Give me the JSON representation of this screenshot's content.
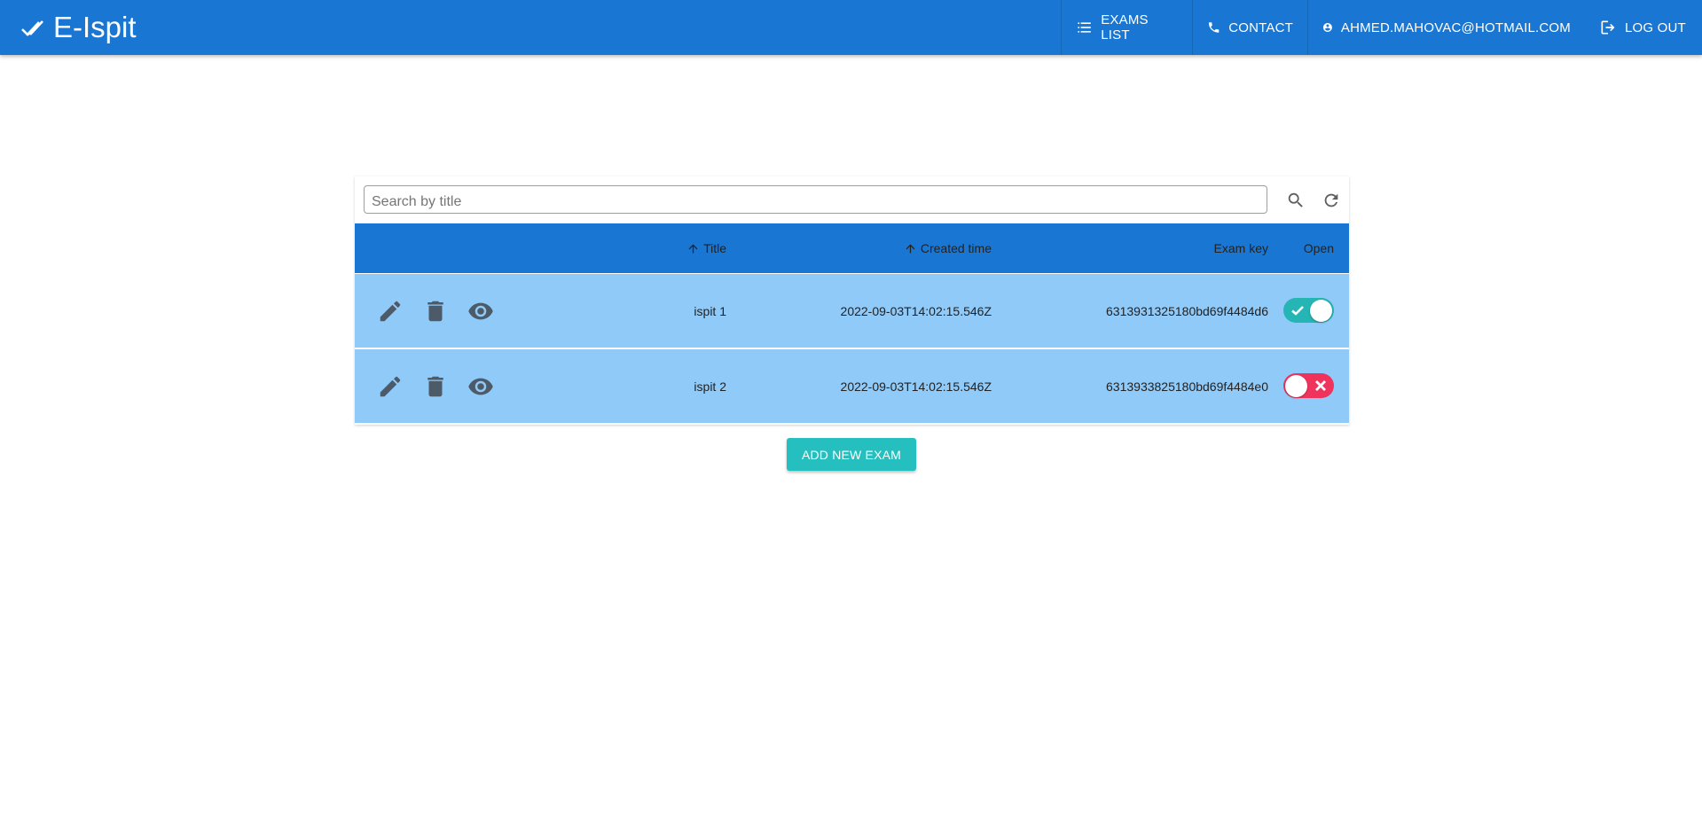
{
  "app": {
    "brand": "E-Ispit"
  },
  "nav": {
    "exams_list": "EXAMS LIST",
    "contact": "CONTACT",
    "user": "AHMED.MAHOVAC@HOTMAIL.COM",
    "logout": "LOG OUT"
  },
  "search": {
    "placeholder": "Search by title",
    "value": ""
  },
  "table": {
    "columns": {
      "title": "Title",
      "created": "Created time",
      "key": "Exam key",
      "open": "Open"
    },
    "rows": [
      {
        "title": "ispit 1",
        "created": "2022-09-03T14:02:15.546Z",
        "key": "6313931325180bd69f4484d6",
        "open": true
      },
      {
        "title": "ispit 2",
        "created": "2022-09-03T14:02:15.546Z",
        "key": "6313933825180bd69f4484e0",
        "open": false
      }
    ]
  },
  "actions": {
    "add_exam": "ADD NEW EXAM"
  },
  "colors": {
    "primary": "#1976d2",
    "row": "#90caf9",
    "toggle_on": "#26b5b5",
    "toggle_off": "#f0335c",
    "add_button": "#26bfbf"
  }
}
